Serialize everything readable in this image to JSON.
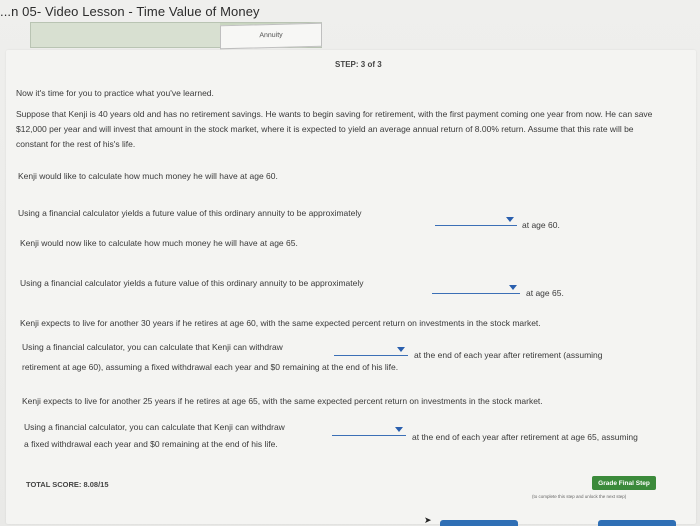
{
  "header": {
    "title": "...n 05- Video Lesson - Time Value of Money",
    "progress_tab_label": "Annuity",
    "progress_fraction": 0.65
  },
  "content": {
    "step": "STEP: 3 of 3",
    "intro": "Now it's time for you to practice what you've learned.",
    "scenario": "Suppose that Kenji is 40 years old and has no retirement savings. He wants to begin saving for retirement, with the first payment coming one year from now. He can save $12,000 per year and will invest that amount in the stock market, where it is expected to yield an average annual return of 8.00% return. Assume that this rate will be constant for the rest of his's life.",
    "q1_intro": "Kenji would like to calculate how much money he will have at age 60.",
    "q1_prompt": "Using a financial calculator yields a future value of this ordinary annuity to be approximately",
    "q1_suffix": "at age 60.",
    "q2_intro": "Kenji would now like to calculate how much money he will have at age 65.",
    "q2_prompt": "Using a financial calculator yields a future value of this ordinary annuity to be approximately",
    "q2_suffix": "at age 65.",
    "q3_intro": "Kenji expects to live for another 30 years if he retires at age 60, with the same expected percent return on investments in the stock market.",
    "q3_prompt": "Using a financial calculator, you can calculate that Kenji can withdraw",
    "q3_suffix": "at the end of each year after retirement (assuming",
    "q3_line2": "retirement at age 60), assuming a fixed withdrawal each year and $0 remaining at the end of his life.",
    "q4_intro": "Kenji expects to live for another 25 years if he retires at age 65, with the same expected percent return on investments in the stock market.",
    "q4_prompt": "Using a financial calculator, you can calculate that Kenji can withdraw",
    "q4_suffix": "at the end of each year after retirement at age 65, assuming",
    "q4_line2": "a fixed withdrawal each year and $0 remaining at the end of his life."
  },
  "footer": {
    "score": "TOTAL SCORE: 8.08/15",
    "grade_button": "Grade Final Step",
    "note": "(to complete this step and unlock the next step)"
  },
  "colors": {
    "accent_blue": "#2a5fae",
    "grade_green": "#3b8a3b"
  }
}
